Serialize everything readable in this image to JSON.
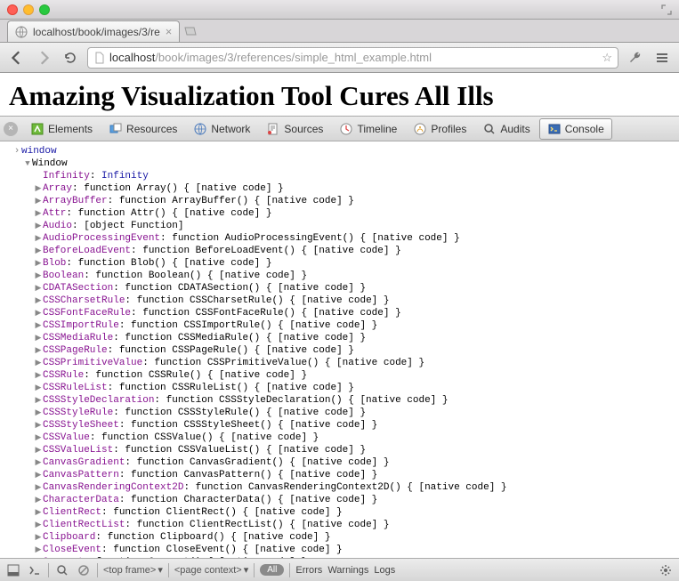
{
  "tab": {
    "title": "localhost/book/images/3/re"
  },
  "url": {
    "host": "localhost",
    "path": "/book/images/3/references/simple_html_example.html"
  },
  "page": {
    "heading": "Amazing Visualization Tool Cures All Ills"
  },
  "devtools": {
    "tabs": [
      "Elements",
      "Resources",
      "Network",
      "Sources",
      "Timeline",
      "Profiles",
      "Audits",
      "Console"
    ],
    "active": "Console"
  },
  "console": {
    "input": "window",
    "root": "Window",
    "props": [
      {
        "expand": false,
        "key": "Infinity",
        "value": "Infinity",
        "kcls": "kpurple",
        "vcls": "vblue"
      },
      {
        "expand": true,
        "key": "Array",
        "value": "function Array() { [native code] }",
        "kcls": "kpurple",
        "vcls": "vblack"
      },
      {
        "expand": true,
        "key": "ArrayBuffer",
        "value": "function ArrayBuffer() { [native code] }",
        "kcls": "kpurple",
        "vcls": "vblack"
      },
      {
        "expand": true,
        "key": "Attr",
        "value": "function Attr() { [native code] }",
        "kcls": "kpurple",
        "vcls": "vblack"
      },
      {
        "expand": true,
        "key": "Audio",
        "value": "[object Function]",
        "kcls": "kpurple",
        "vcls": "vblack"
      },
      {
        "expand": true,
        "key": "AudioProcessingEvent",
        "value": "function AudioProcessingEvent() { [native code] }",
        "kcls": "kpurple",
        "vcls": "vblack"
      },
      {
        "expand": true,
        "key": "BeforeLoadEvent",
        "value": "function BeforeLoadEvent() { [native code] }",
        "kcls": "kpurple",
        "vcls": "vblack"
      },
      {
        "expand": true,
        "key": "Blob",
        "value": "function Blob() { [native code] }",
        "kcls": "kpurple",
        "vcls": "vblack"
      },
      {
        "expand": true,
        "key": "Boolean",
        "value": "function Boolean() { [native code] }",
        "kcls": "kpurple",
        "vcls": "vblack"
      },
      {
        "expand": true,
        "key": "CDATASection",
        "value": "function CDATASection() { [native code] }",
        "kcls": "kpurple",
        "vcls": "vblack"
      },
      {
        "expand": true,
        "key": "CSSCharsetRule",
        "value": "function CSSCharsetRule() { [native code] }",
        "kcls": "kpurple",
        "vcls": "vblack"
      },
      {
        "expand": true,
        "key": "CSSFontFaceRule",
        "value": "function CSSFontFaceRule() { [native code] }",
        "kcls": "kpurple",
        "vcls": "vblack"
      },
      {
        "expand": true,
        "key": "CSSImportRule",
        "value": "function CSSImportRule() { [native code] }",
        "kcls": "kpurple",
        "vcls": "vblack"
      },
      {
        "expand": true,
        "key": "CSSMediaRule",
        "value": "function CSSMediaRule() { [native code] }",
        "kcls": "kpurple",
        "vcls": "vblack"
      },
      {
        "expand": true,
        "key": "CSSPageRule",
        "value": "function CSSPageRule() { [native code] }",
        "kcls": "kpurple",
        "vcls": "vblack"
      },
      {
        "expand": true,
        "key": "CSSPrimitiveValue",
        "value": "function CSSPrimitiveValue() { [native code] }",
        "kcls": "kpurple",
        "vcls": "vblack"
      },
      {
        "expand": true,
        "key": "CSSRule",
        "value": "function CSSRule() { [native code] }",
        "kcls": "kpurple",
        "vcls": "vblack"
      },
      {
        "expand": true,
        "key": "CSSRuleList",
        "value": "function CSSRuleList() { [native code] }",
        "kcls": "kpurple",
        "vcls": "vblack"
      },
      {
        "expand": true,
        "key": "CSSStyleDeclaration",
        "value": "function CSSStyleDeclaration() { [native code] }",
        "kcls": "kpurple",
        "vcls": "vblack"
      },
      {
        "expand": true,
        "key": "CSSStyleRule",
        "value": "function CSSStyleRule() { [native code] }",
        "kcls": "kpurple",
        "vcls": "vblack"
      },
      {
        "expand": true,
        "key": "CSSStyleSheet",
        "value": "function CSSStyleSheet() { [native code] }",
        "kcls": "kpurple",
        "vcls": "vblack"
      },
      {
        "expand": true,
        "key": "CSSValue",
        "value": "function CSSValue() { [native code] }",
        "kcls": "kpurple",
        "vcls": "vblack"
      },
      {
        "expand": true,
        "key": "CSSValueList",
        "value": "function CSSValueList() { [native code] }",
        "kcls": "kpurple",
        "vcls": "vblack"
      },
      {
        "expand": true,
        "key": "CanvasGradient",
        "value": "function CanvasGradient() { [native code] }",
        "kcls": "kpurple",
        "vcls": "vblack"
      },
      {
        "expand": true,
        "key": "CanvasPattern",
        "value": "function CanvasPattern() { [native code] }",
        "kcls": "kpurple",
        "vcls": "vblack"
      },
      {
        "expand": true,
        "key": "CanvasRenderingContext2D",
        "value": "function CanvasRenderingContext2D() { [native code] }",
        "kcls": "kpurple",
        "vcls": "vblack"
      },
      {
        "expand": true,
        "key": "CharacterData",
        "value": "function CharacterData() { [native code] }",
        "kcls": "kpurple",
        "vcls": "vblack"
      },
      {
        "expand": true,
        "key": "ClientRect",
        "value": "function ClientRect() { [native code] }",
        "kcls": "kpurple",
        "vcls": "vblack"
      },
      {
        "expand": true,
        "key": "ClientRectList",
        "value": "function ClientRectList() { [native code] }",
        "kcls": "kpurple",
        "vcls": "vblack"
      },
      {
        "expand": true,
        "key": "Clipboard",
        "value": "function Clipboard() { [native code] }",
        "kcls": "kpurple",
        "vcls": "vblack"
      },
      {
        "expand": true,
        "key": "CloseEvent",
        "value": "function CloseEvent() { [native code] }",
        "kcls": "kpurple",
        "vcls": "vblack"
      },
      {
        "expand": true,
        "key": "Comment",
        "value": "function Comment() { [native code] }",
        "kcls": "kpurple",
        "vcls": "vblack"
      }
    ]
  },
  "status": {
    "frame": "<top frame>",
    "context": "<page context>",
    "filters": {
      "all": "All",
      "errors": "Errors",
      "warnings": "Warnings",
      "logs": "Logs"
    }
  }
}
